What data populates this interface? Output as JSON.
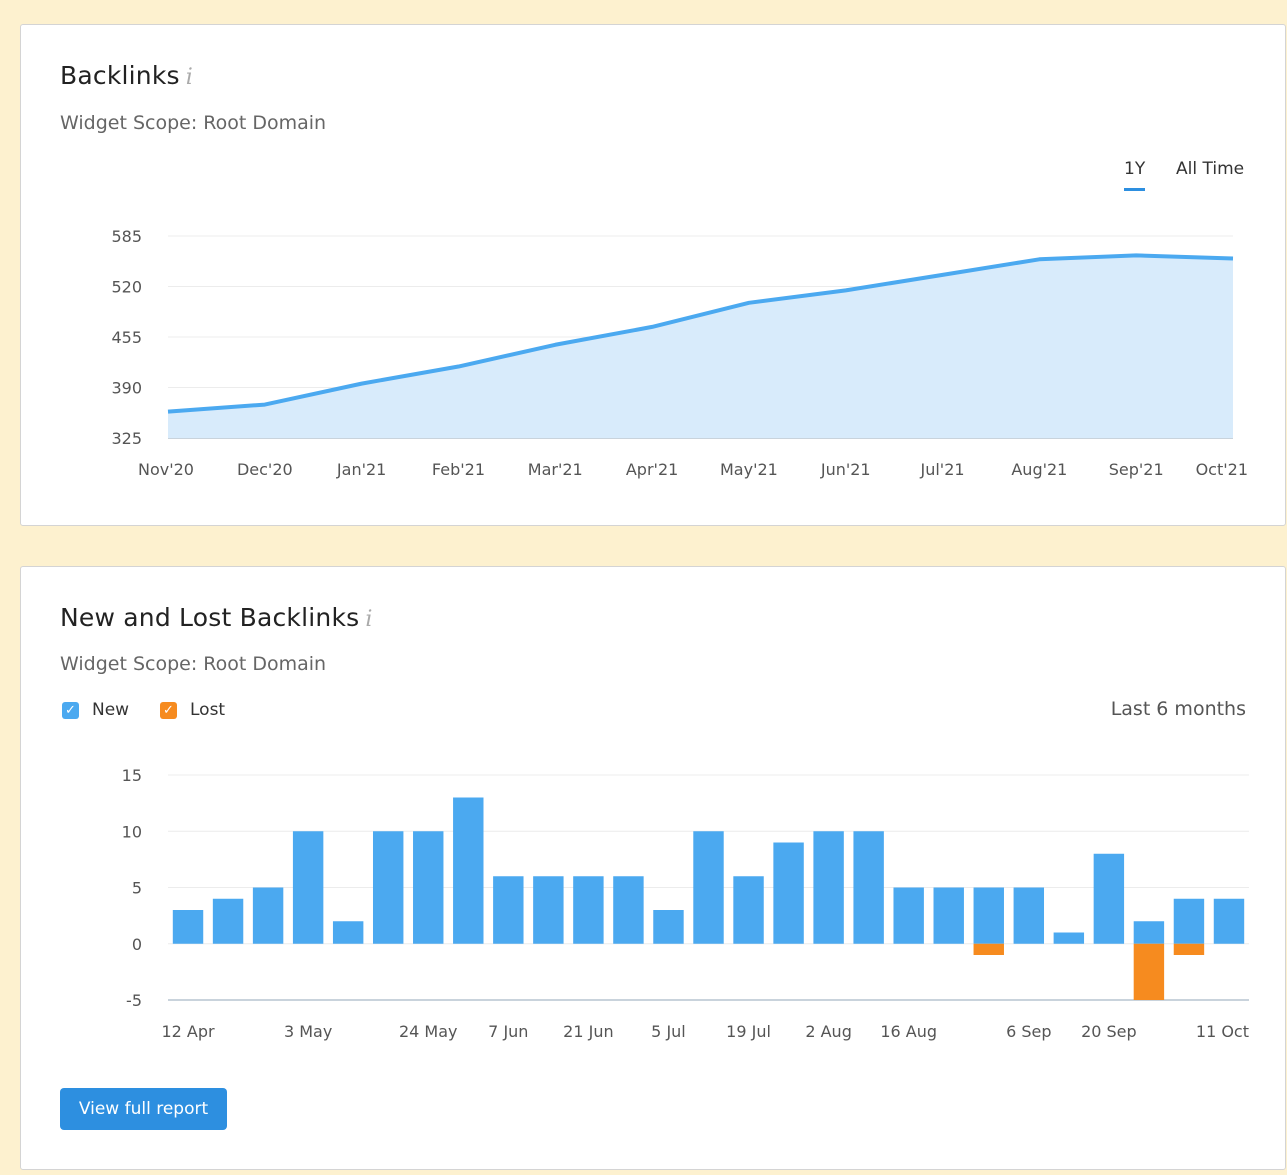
{
  "backlinks_card": {
    "title": "Backlinks",
    "info_glyph": "i",
    "scope": "Widget Scope: Root Domain",
    "toggles": [
      "1Y",
      "All Time"
    ],
    "active_toggle": "1Y",
    "colors": {
      "line": "#4ba9f0",
      "area": "#d8ebfb"
    }
  },
  "new_lost_card": {
    "title": "New and Lost Backlinks",
    "info_glyph": "i",
    "scope": "Widget Scope: Root Domain",
    "legend": [
      {
        "label": "New",
        "color": "#4ba9f0",
        "checked": true
      },
      {
        "label": "Lost",
        "color": "#f68b1f",
        "checked": true
      }
    ],
    "period": "Last 6 months",
    "button_label": "View full report"
  },
  "chart_data": [
    {
      "type": "area",
      "title": "Backlinks",
      "x": [
        "Nov'20",
        "Dec'20",
        "Jan'21",
        "Feb'21",
        "Mar'21",
        "Apr'21",
        "May'21",
        "Jun'21",
        "Jul'21",
        "Aug'21",
        "Sep'21",
        "Oct'21"
      ],
      "values": [
        359,
        368,
        395,
        417,
        445,
        468,
        499,
        515,
        535,
        555,
        560,
        556
      ],
      "yticks": [
        325,
        390,
        455,
        520,
        585
      ],
      "ylim": [
        325,
        585
      ],
      "grid": true
    },
    {
      "type": "bar",
      "title": "New and Lost Backlinks",
      "xtick_labels": [
        "12 Apr",
        "3 May",
        "24 May",
        "7 Jun",
        "21 Jun",
        "5 Jul",
        "19 Jul",
        "2 Aug",
        "16 Aug",
        "6 Sep",
        "20 Sep",
        "11 Oct"
      ],
      "series": [
        {
          "name": "New",
          "color": "#4ba9f0",
          "values": [
            3,
            4,
            5,
            10,
            2,
            10,
            10,
            13,
            6,
            6,
            6,
            6,
            3,
            10,
            6,
            9,
            10,
            10,
            5,
            5,
            5,
            5,
            1,
            8,
            2,
            4,
            4
          ]
        },
        {
          "name": "Lost",
          "color": "#f68b1f",
          "values": [
            0,
            0,
            0,
            0,
            0,
            0,
            0,
            0,
            0,
            0,
            0,
            0,
            0,
            0,
            0,
            0,
            0,
            0,
            0,
            0,
            -1,
            0,
            0,
            0,
            -5,
            -1,
            0
          ]
        }
      ],
      "yticks": [
        -5,
        0,
        5,
        10,
        15
      ],
      "ylim": [
        -5,
        15
      ],
      "grid": true
    }
  ]
}
